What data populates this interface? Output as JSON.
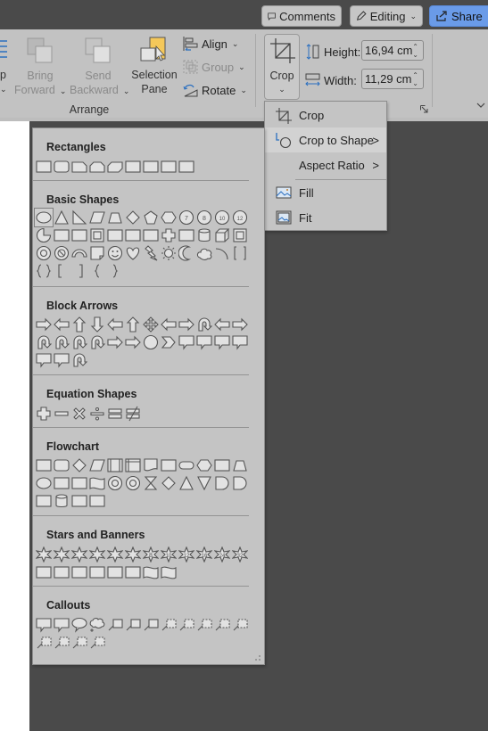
{
  "titlebar": {
    "comments_label": "Comments",
    "editing_label": "Editing",
    "share_label": "Share"
  },
  "ribbon": {
    "partial_label_1": "p",
    "bring_forward": [
      "Bring",
      "Forward"
    ],
    "send_backward": [
      "Send",
      "Backward"
    ],
    "selection_pane": [
      "Selection",
      "Pane"
    ],
    "align_label": "Align",
    "group_label": "Group",
    "rotate_label": "Rotate",
    "arrange_group_label": "Arrange",
    "crop_label": "Crop",
    "height_label": "Height:",
    "height_value": "16,94 cm",
    "width_label": "Width:",
    "width_value": "11,29 cm",
    "accent_color": "#f5c85a"
  },
  "crop_menu": {
    "items": [
      {
        "label": "Crop",
        "icon": "crop-icon",
        "submenu": false
      },
      {
        "label": "Crop to Shape",
        "icon": "crop-to-shape-icon",
        "submenu": true,
        "highlighted": true
      },
      {
        "label": "Aspect Ratio",
        "icon": "",
        "submenu": true
      },
      {
        "label": "Fill",
        "icon": "fill-image-icon",
        "submenu": false
      },
      {
        "label": "Fit",
        "icon": "fit-image-icon",
        "submenu": false
      }
    ],
    "submenu_glyph": ">"
  },
  "gallery": {
    "sections": [
      {
        "title": "Rectangles",
        "rows": [
          [
            "rect",
            "round-rect",
            "snip-one",
            "snip-same",
            "snip-diag",
            "snip-round",
            "round-one",
            "round-same",
            "round-diag"
          ]
        ]
      },
      {
        "title": "Basic Shapes",
        "rows": [
          [
            "oval",
            "triangle",
            "right-triangle",
            "parallelogram",
            "trapezoid",
            "diamond",
            "pentagon",
            "hexagon",
            "heptagon-7",
            "octagon-8",
            "decagon-10",
            "dodecagon-12"
          ],
          [
            "pie",
            "chord",
            "teardrop",
            "frame",
            "half-frame",
            "l-shape",
            "diagonal-stripe",
            "cross",
            "plaque",
            "can",
            "cube",
            "bevel"
          ],
          [
            "donut",
            "no-symbol",
            "block-arc",
            "folded-corner",
            "smiley",
            "heart",
            "lightning",
            "sun",
            "moon",
            "cloud",
            "arc",
            "double-bracket"
          ],
          [
            "double-brace",
            "left-bracket",
            "right-bracket",
            "left-brace",
            "right-brace"
          ]
        ]
      },
      {
        "title": "Block Arrows",
        "rows": [
          [
            "right-arrow",
            "left-arrow",
            "up-arrow",
            "down-arrow",
            "left-right-arrow",
            "up-down-arrow",
            "quad-arrow",
            "left-right-up-arrow",
            "bent-arrow",
            "u-turn-arrow",
            "left-up-arrow",
            "bent-up-arrow"
          ],
          [
            "curved-right-arrow",
            "curved-left-arrow",
            "curved-up-arrow",
            "curved-down-arrow",
            "striped-right-arrow",
            "notched-right-arrow",
            "pentagon-arrow",
            "chevron",
            "right-arrow-callout",
            "down-arrow-callout",
            "left-arrow-callout",
            "up-arrow-callout"
          ],
          [
            "left-right-arrow-callout",
            "quad-arrow-callout",
            "circular-arrow"
          ]
        ]
      },
      {
        "title": "Equation Shapes",
        "rows": [
          [
            "plus",
            "minus",
            "multiply",
            "division",
            "equal",
            "not-equal"
          ]
        ]
      },
      {
        "title": "Flowchart",
        "rows": [
          [
            "process",
            "alternate-process",
            "decision",
            "data",
            "predefined-process",
            "internal-storage",
            "document",
            "multidocument",
            "terminator",
            "preparation",
            "manual-input",
            "manual-operation"
          ],
          [
            "connector",
            "off-page-connector",
            "card",
            "punched-tape",
            "summing-junction",
            "or",
            "collate",
            "sort",
            "extract",
            "merge",
            "stored-data",
            "delay"
          ],
          [
            "sequential-access-storage",
            "magnetic-disk",
            "direct-access-storage",
            "display"
          ]
        ]
      },
      {
        "title": "Stars and Banners",
        "rows": [
          [
            "explosion-1",
            "explosion-2",
            "star-4",
            "star-5",
            "star-6",
            "star-7",
            "star-8",
            "star-10",
            "star-12",
            "star-16",
            "star-24",
            "star-32"
          ],
          [
            "ribbon-tilted-up",
            "ribbon-tilted-down",
            "curved-ribbon-up",
            "curved-ribbon-down",
            "vertical-scroll",
            "horizontal-scroll",
            "wave",
            "double-wave"
          ]
        ]
      },
      {
        "title": "Callouts",
        "rows": [
          [
            "rect-callout",
            "rounded-rect-callout",
            "oval-callout",
            "cloud-callout",
            "line-callout-1",
            "line-callout-2",
            "line-callout-3",
            "line-callout-1-accent",
            "line-callout-2-accent",
            "line-callout-3-accent",
            "line-callout-1-no-border",
            "line-callout-2-no-border"
          ],
          [
            "line-callout-3-no-border",
            "line-callout-1-border-accent",
            "line-callout-2-border-accent",
            "line-callout-3-border-accent"
          ]
        ]
      }
    ],
    "star_numbers": {
      "star-8": "8",
      "star-10": "10",
      "star-12": "12",
      "star-16": "16",
      "star-24": "24",
      "star-32": "32",
      "heptagon-7": "7",
      "octagon-8": "8",
      "decagon-10": "10",
      "dodecagon-12": "12"
    }
  }
}
